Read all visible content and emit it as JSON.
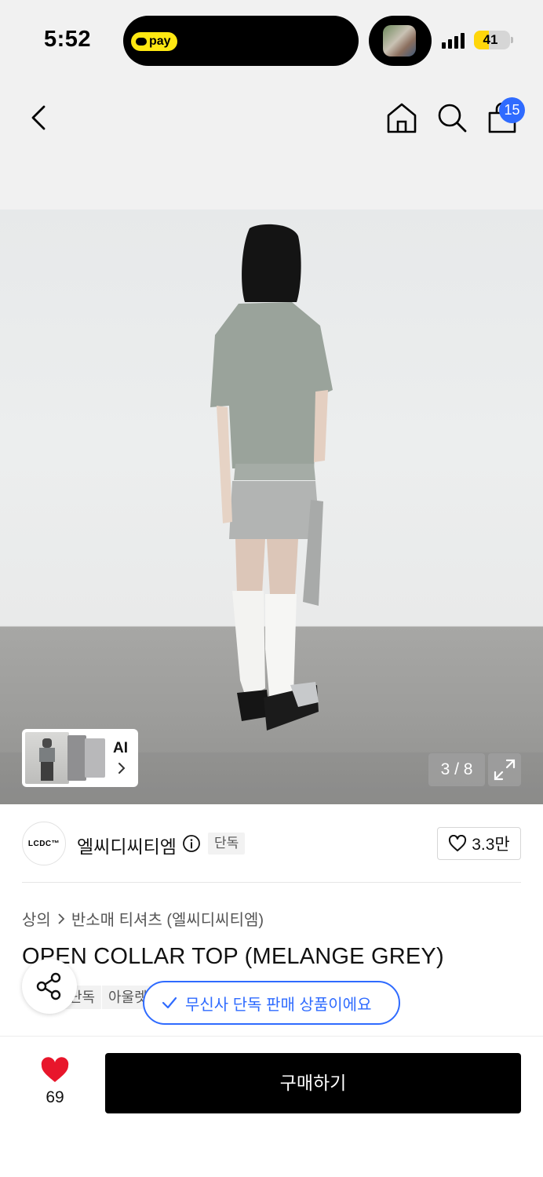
{
  "status_bar": {
    "time": "5:52",
    "pay_label": "pay",
    "battery": "41",
    "battery_level": 0.41
  },
  "header": {
    "cart_count": "15",
    "icons": [
      "back-icon",
      "home-icon",
      "search-icon",
      "cart-icon"
    ]
  },
  "gallery": {
    "ai_label": "AI",
    "counter": "3 / 8"
  },
  "brand": {
    "logo_text": "LCDC™",
    "name": "엘씨디씨티엠",
    "exclusive_tag": "단독",
    "likes": "3.3만"
  },
  "product": {
    "breadcrumb": [
      "상의",
      "반소매 티셔츠 (엘씨디씨티엠)"
    ],
    "title": "OPEN COLLAR TOP (MELANGE GREY)",
    "tags": [
      "단독",
      "아울렛"
    ],
    "exclusive_notice": "무신사 단독 판매 상품이에요"
  },
  "bottom_bar": {
    "wish_count": "69",
    "buy_label": "구매하기"
  },
  "colors": {
    "accent_blue": "#2f6bff",
    "heart_red": "#e8162b",
    "buy_button": "#000000"
  }
}
